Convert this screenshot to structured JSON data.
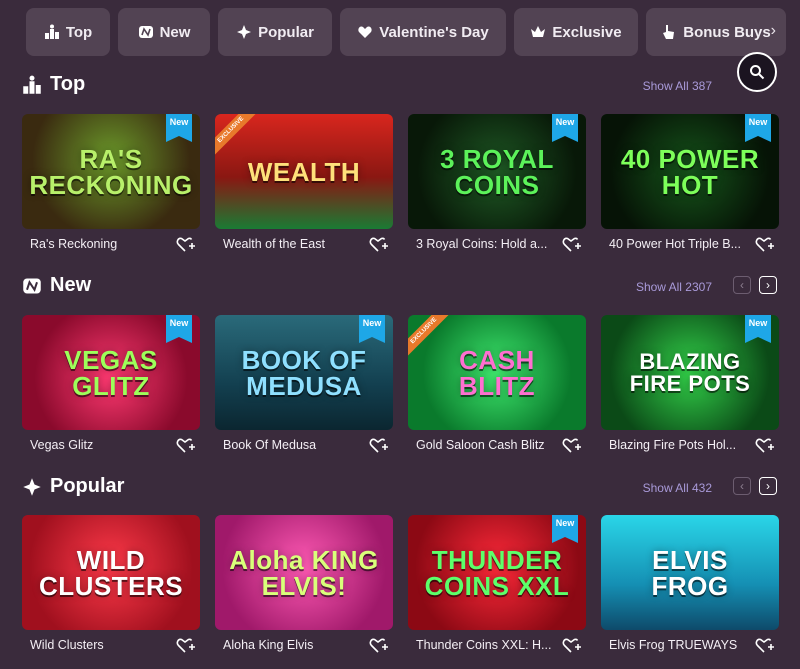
{
  "tabs": [
    {
      "label": "Top",
      "icon": "podium-icon"
    },
    {
      "label": "New",
      "icon": "new-badge-icon"
    },
    {
      "label": "Popular",
      "icon": "sparkle-icon"
    },
    {
      "label": "Valentine's Day",
      "icon": "heart-icon"
    },
    {
      "label": "Exclusive",
      "icon": "crown-icon"
    },
    {
      "label": "Bonus Buys",
      "icon": "pointer-icon"
    }
  ],
  "colors": {
    "background": "#3a2b3c",
    "tab_bg": "#524353",
    "link": "#a99ad9",
    "new_badge": "#1ea7e7",
    "exclusive_badge": "#e8792b"
  },
  "sections": [
    {
      "title": "Top",
      "icon": "podium-icon",
      "show_all": "Show All 387",
      "games": [
        {
          "name": "Ra's Reckoning",
          "art": "RA'S RECKONING",
          "badge": "New"
        },
        {
          "name": "Wealth of the East",
          "art": "WEALTH",
          "badge": "",
          "exclusive": "EXCLUSIVE"
        },
        {
          "name": "3 Royal Coins: Hold a...",
          "art": "3 ROYAL COINS",
          "badge": "New"
        },
        {
          "name": "40 Power Hot Triple B...",
          "art": "40 POWER HOT",
          "badge": "New"
        }
      ]
    },
    {
      "title": "New",
      "icon": "new-badge-icon",
      "show_all": "Show All 2307",
      "games": [
        {
          "name": "Vegas Glitz",
          "art": "VEGAS GLITZ",
          "badge": "New"
        },
        {
          "name": "Book Of Medusa",
          "art": "BOOK OF MEDUSA",
          "badge": "New"
        },
        {
          "name": "Gold Saloon Cash Blitz",
          "art": "CASH BLITZ",
          "badge": "",
          "exclusive": "EXCLUSIVE"
        },
        {
          "name": "Blazing Fire Pots Hol...",
          "art": "BLAZING FIRE POTS",
          "badge": "New"
        }
      ]
    },
    {
      "title": "Popular",
      "icon": "sparkle-icon",
      "show_all": "Show All 432",
      "games": [
        {
          "name": "Wild Clusters",
          "art": "WILD CLUSTERS",
          "badge": ""
        },
        {
          "name": "Aloha King Elvis",
          "art": "Aloha KING ELVIS!",
          "badge": ""
        },
        {
          "name": "Thunder Coins XXL: H...",
          "art": "THUNDER COINS XXL",
          "badge": "New"
        },
        {
          "name": "Elvis Frog TRUEWAYS",
          "art": "ELVIS FROG",
          "badge": ""
        }
      ]
    }
  ]
}
